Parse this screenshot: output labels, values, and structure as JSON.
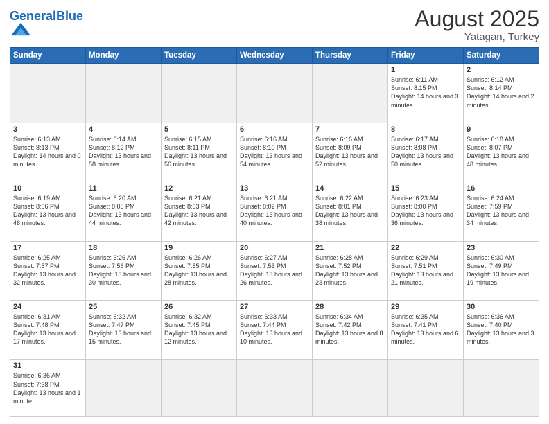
{
  "header": {
    "logo_general": "General",
    "logo_blue": "Blue",
    "month_year": "August 2025",
    "location": "Yatagan, Turkey"
  },
  "weekdays": [
    "Sunday",
    "Monday",
    "Tuesday",
    "Wednesday",
    "Thursday",
    "Friday",
    "Saturday"
  ],
  "weeks": [
    [
      {
        "day": "",
        "empty": true
      },
      {
        "day": "",
        "empty": true
      },
      {
        "day": "",
        "empty": true
      },
      {
        "day": "",
        "empty": true
      },
      {
        "day": "",
        "empty": true
      },
      {
        "day": "1",
        "info": "Sunrise: 6:11 AM\nSunset: 8:15 PM\nDaylight: 14 hours and 3 minutes."
      },
      {
        "day": "2",
        "info": "Sunrise: 6:12 AM\nSunset: 8:14 PM\nDaylight: 14 hours and 2 minutes."
      }
    ],
    [
      {
        "day": "3",
        "info": "Sunrise: 6:13 AM\nSunset: 8:13 PM\nDaylight: 14 hours and 0 minutes."
      },
      {
        "day": "4",
        "info": "Sunrise: 6:14 AM\nSunset: 8:12 PM\nDaylight: 13 hours and 58 minutes."
      },
      {
        "day": "5",
        "info": "Sunrise: 6:15 AM\nSunset: 8:11 PM\nDaylight: 13 hours and 56 minutes."
      },
      {
        "day": "6",
        "info": "Sunrise: 6:16 AM\nSunset: 8:10 PM\nDaylight: 13 hours and 54 minutes."
      },
      {
        "day": "7",
        "info": "Sunrise: 6:16 AM\nSunset: 8:09 PM\nDaylight: 13 hours and 52 minutes."
      },
      {
        "day": "8",
        "info": "Sunrise: 6:17 AM\nSunset: 8:08 PM\nDaylight: 13 hours and 50 minutes."
      },
      {
        "day": "9",
        "info": "Sunrise: 6:18 AM\nSunset: 8:07 PM\nDaylight: 13 hours and 48 minutes."
      }
    ],
    [
      {
        "day": "10",
        "info": "Sunrise: 6:19 AM\nSunset: 8:06 PM\nDaylight: 13 hours and 46 minutes."
      },
      {
        "day": "11",
        "info": "Sunrise: 6:20 AM\nSunset: 8:05 PM\nDaylight: 13 hours and 44 minutes."
      },
      {
        "day": "12",
        "info": "Sunrise: 6:21 AM\nSunset: 8:03 PM\nDaylight: 13 hours and 42 minutes."
      },
      {
        "day": "13",
        "info": "Sunrise: 6:21 AM\nSunset: 8:02 PM\nDaylight: 13 hours and 40 minutes."
      },
      {
        "day": "14",
        "info": "Sunrise: 6:22 AM\nSunset: 8:01 PM\nDaylight: 13 hours and 38 minutes."
      },
      {
        "day": "15",
        "info": "Sunrise: 6:23 AM\nSunset: 8:00 PM\nDaylight: 13 hours and 36 minutes."
      },
      {
        "day": "16",
        "info": "Sunrise: 6:24 AM\nSunset: 7:59 PM\nDaylight: 13 hours and 34 minutes."
      }
    ],
    [
      {
        "day": "17",
        "info": "Sunrise: 6:25 AM\nSunset: 7:57 PM\nDaylight: 13 hours and 32 minutes."
      },
      {
        "day": "18",
        "info": "Sunrise: 6:26 AM\nSunset: 7:56 PM\nDaylight: 13 hours and 30 minutes."
      },
      {
        "day": "19",
        "info": "Sunrise: 6:26 AM\nSunset: 7:55 PM\nDaylight: 13 hours and 28 minutes."
      },
      {
        "day": "20",
        "info": "Sunrise: 6:27 AM\nSunset: 7:53 PM\nDaylight: 13 hours and 26 minutes."
      },
      {
        "day": "21",
        "info": "Sunrise: 6:28 AM\nSunset: 7:52 PM\nDaylight: 13 hours and 23 minutes."
      },
      {
        "day": "22",
        "info": "Sunrise: 6:29 AM\nSunset: 7:51 PM\nDaylight: 13 hours and 21 minutes."
      },
      {
        "day": "23",
        "info": "Sunrise: 6:30 AM\nSunset: 7:49 PM\nDaylight: 13 hours and 19 minutes."
      }
    ],
    [
      {
        "day": "24",
        "info": "Sunrise: 6:31 AM\nSunset: 7:48 PM\nDaylight: 13 hours and 17 minutes."
      },
      {
        "day": "25",
        "info": "Sunrise: 6:32 AM\nSunset: 7:47 PM\nDaylight: 13 hours and 15 minutes."
      },
      {
        "day": "26",
        "info": "Sunrise: 6:32 AM\nSunset: 7:45 PM\nDaylight: 13 hours and 12 minutes."
      },
      {
        "day": "27",
        "info": "Sunrise: 6:33 AM\nSunset: 7:44 PM\nDaylight: 13 hours and 10 minutes."
      },
      {
        "day": "28",
        "info": "Sunrise: 6:34 AM\nSunset: 7:42 PM\nDaylight: 13 hours and 8 minutes."
      },
      {
        "day": "29",
        "info": "Sunrise: 6:35 AM\nSunset: 7:41 PM\nDaylight: 13 hours and 6 minutes."
      },
      {
        "day": "30",
        "info": "Sunrise: 6:36 AM\nSunset: 7:40 PM\nDaylight: 13 hours and 3 minutes."
      }
    ],
    [
      {
        "day": "31",
        "info": "Sunrise: 6:36 AM\nSunset: 7:38 PM\nDaylight: 13 hours and 1 minute."
      },
      {
        "day": "",
        "empty": true
      },
      {
        "day": "",
        "empty": true
      },
      {
        "day": "",
        "empty": true
      },
      {
        "day": "",
        "empty": true
      },
      {
        "day": "",
        "empty": true
      },
      {
        "day": "",
        "empty": true
      }
    ]
  ]
}
